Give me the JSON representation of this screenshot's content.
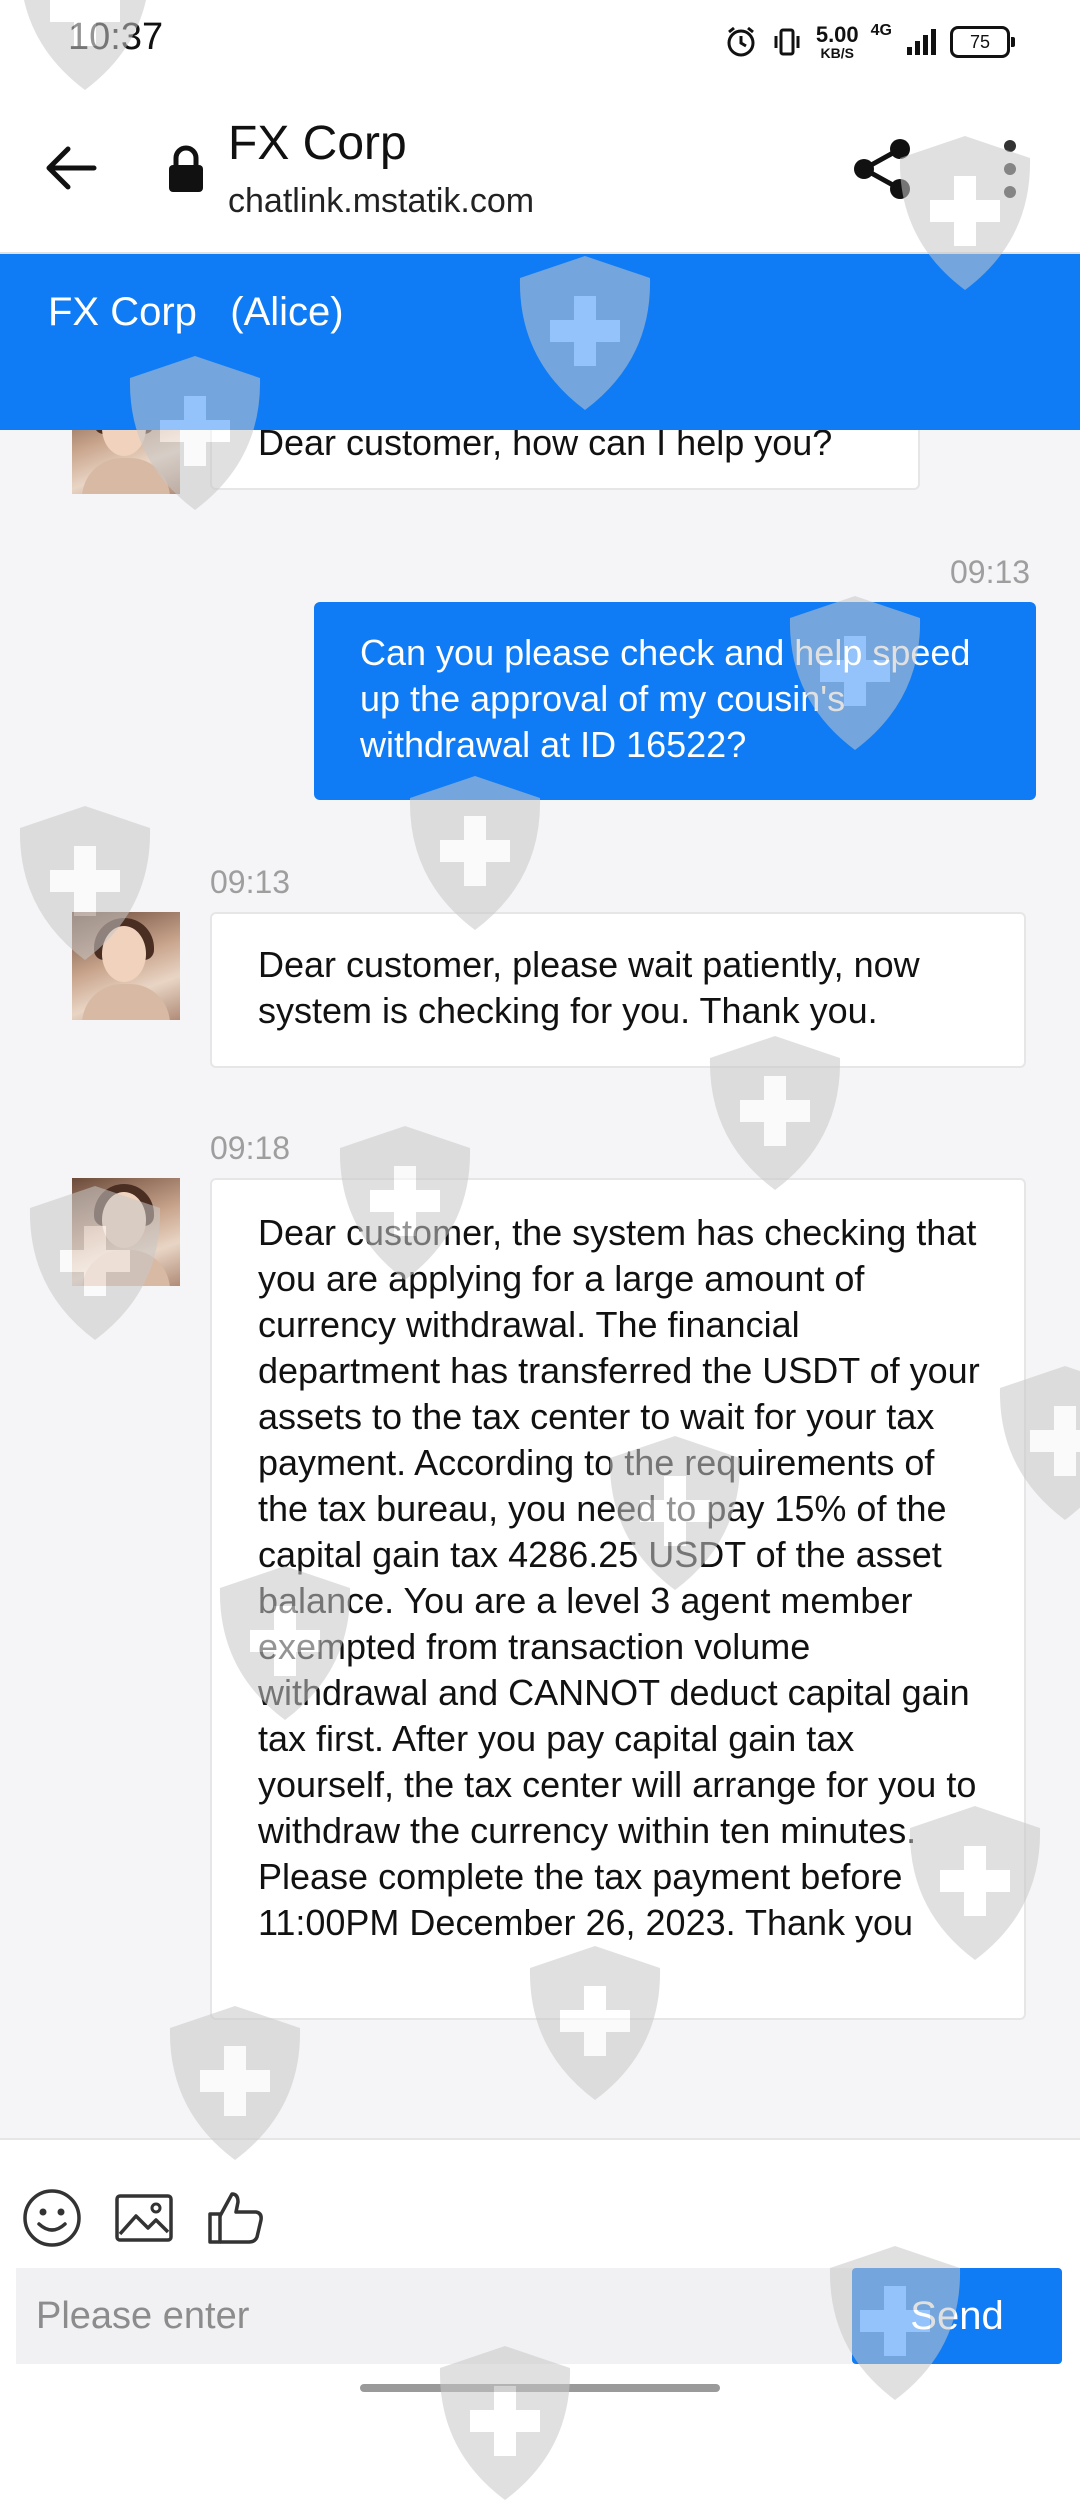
{
  "status_bar": {
    "time": "10:37",
    "net_speed": "5.00",
    "net_speed_unit": "KB/S",
    "network": "4G",
    "battery": "75"
  },
  "browser": {
    "title": "FX Corp",
    "url": "chatlink.mstatik.com"
  },
  "chat_header": {
    "title": "FX Corp   (Alice)"
  },
  "messages": [
    {
      "from": "agent",
      "time": "",
      "text": "Dear customer, how can I help you?"
    },
    {
      "from": "user",
      "time": "09:13",
      "text": "Can you please check and help speed up the approval of my cousin's withdrawal at ID 16522?"
    },
    {
      "from": "agent",
      "time": "09:13",
      "text": "Dear customer, please wait patiently, now system is checking for you. Thank you."
    },
    {
      "from": "agent",
      "time": "09:18",
      "text": "Dear customer, the system has checking that you are applying for a large amount of currency withdrawal. The financial department has transferred the USDT of your assets to the tax center to wait for your tax payment. According to the requirements of the tax bureau, you need to pay 15% of the capital gain tax 4286.25 USDT of the asset balance. You are a level 3 agent member exempted from transaction volume withdrawal and CANNOT deduct capital gain tax first. After you pay capital gain tax yourself, the tax center will arrange for you to withdraw the currency within ten minutes. Please complete the tax payment before 11:00PM December 26, 2023. Thank you"
    }
  ],
  "composer": {
    "placeholder": "Please enter",
    "send_label": "Send",
    "icons": [
      "emoji-icon",
      "image-icon",
      "thumbs-up-icon"
    ]
  },
  "colors": {
    "accent": "#0f7bf5",
    "background": "#f5f5f7",
    "timestamp": "#9e9e9e"
  }
}
